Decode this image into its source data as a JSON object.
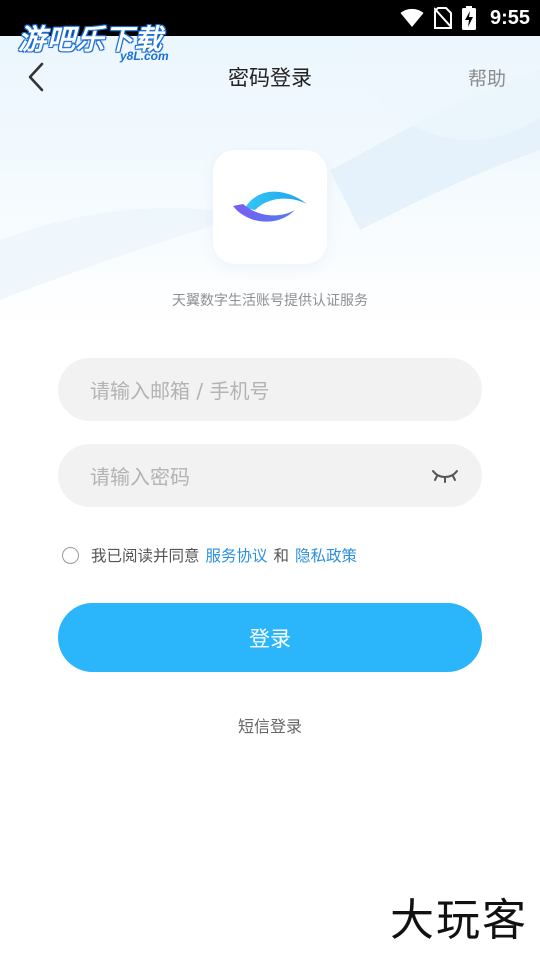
{
  "status_bar": {
    "time": "9:55"
  },
  "watermark": {
    "top": "游吧乐下载",
    "top_sub": "y8L.com",
    "bottom": "大玩客"
  },
  "header": {
    "title": "密码登录",
    "help": "帮助"
  },
  "brand": {
    "caption": "天翼数字生活账号提供认证服务"
  },
  "form": {
    "account_placeholder": "请输入邮箱 / 手机号",
    "password_placeholder": "请输入密码",
    "agreement_prefix": "我已阅读并同意",
    "service_link": "服务协议",
    "and_text": "和",
    "privacy_link": "隐私政策",
    "login_label": "登录",
    "sms_login_label": "短信登录"
  },
  "colors": {
    "accent": "#2bb5fa",
    "link": "#2b8fe0",
    "status_bar": "#000000"
  }
}
